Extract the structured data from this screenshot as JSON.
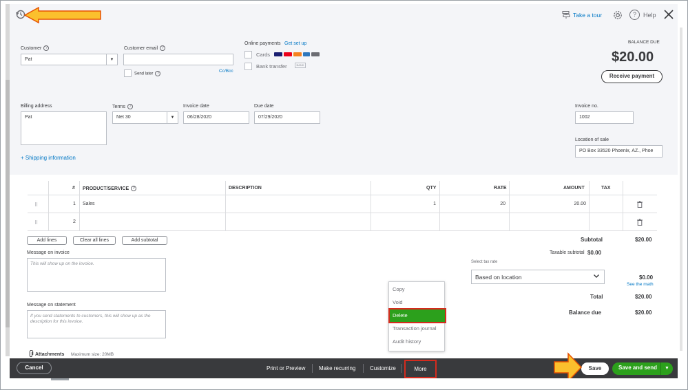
{
  "header": {
    "take_tour": "Take a tour",
    "help": "Help"
  },
  "balance": {
    "label": "BALANCE DUE",
    "amount": "$20.00",
    "receive_payment": "Receive payment"
  },
  "customer": {
    "label": "Customer",
    "value": "Pat",
    "email_label": "Customer email",
    "email_value": "",
    "send_later": "Send later",
    "cc_bcc": "Cc/Bcc"
  },
  "online_payments": {
    "label": "Online payments",
    "get_set_up": "Get set up",
    "cards": "Cards",
    "bank_transfer": "Bank transfer",
    "bank_badge": "BANK"
  },
  "billing": {
    "label": "Billing address",
    "value": "Pat",
    "shipping_link": "+ Shipping information"
  },
  "terms": {
    "label": "Terms",
    "value": "Net 30"
  },
  "invoice_date": {
    "label": "Invoice date",
    "value": "06/28/2020"
  },
  "due_date": {
    "label": "Due date",
    "value": "07/29/2020"
  },
  "invoice_no": {
    "label": "Invoice no.",
    "value": "1002"
  },
  "location_of_sale": {
    "label": "Location of sale",
    "value": "PO Box 33520 Phoenix, AZ., Phoe"
  },
  "table": {
    "headers": {
      "num": "#",
      "product": "PRODUCT/SERVICE",
      "description": "DESCRIPTION",
      "qty": "QTY",
      "rate": "RATE",
      "amount": "AMOUNT",
      "tax": "TAX"
    },
    "rows": [
      {
        "num": "1",
        "product": "Sales",
        "description": "",
        "qty": "1",
        "rate": "20",
        "amount": "20.00"
      },
      {
        "num": "2",
        "product": "",
        "description": "",
        "qty": "",
        "rate": "",
        "amount": ""
      }
    ]
  },
  "line_buttons": {
    "add_lines": "Add lines",
    "clear_all": "Clear all lines",
    "add_subtotal": "Add subtotal"
  },
  "message_invoice": {
    "label": "Message on invoice",
    "placeholder": "This will show up on the invoice."
  },
  "message_statement": {
    "label": "Message on statement",
    "placeholder": "If you send statements to customers, this will show up as the description for this invoice."
  },
  "attachments": {
    "label": "Attachments",
    "max_size": "Maximum size: 20MB"
  },
  "totals": {
    "subtotal_label": "Subtotal",
    "subtotal_value": "$20.00",
    "taxable_label": "Taxable subtotal",
    "taxable_value": "$0.00",
    "select_tax_rate": "Select tax rate",
    "tax_rate_value": "Based on location",
    "tax_value": "$0.00",
    "see_math": "See the math",
    "total_label": "Total",
    "total_value": "$20.00",
    "balance_due_label": "Balance due",
    "balance_due_value": "$20.00"
  },
  "more_menu": {
    "items": [
      "Copy",
      "Void",
      "Delete",
      "Transaction journal",
      "Audit history"
    ],
    "selected": "Delete"
  },
  "footer": {
    "cancel": "Cancel",
    "print_preview": "Print or Preview",
    "make_recurring": "Make recurring",
    "customize": "Customize",
    "more": "More",
    "save": "Save",
    "save_and_send": "Save and send"
  },
  "colors": {
    "accent_green": "#2ca01c",
    "link_blue": "#0077c5",
    "footer_bg": "#393a3d",
    "highlight_red": "#d52b1e",
    "arrow_orange": "#f5a623"
  }
}
